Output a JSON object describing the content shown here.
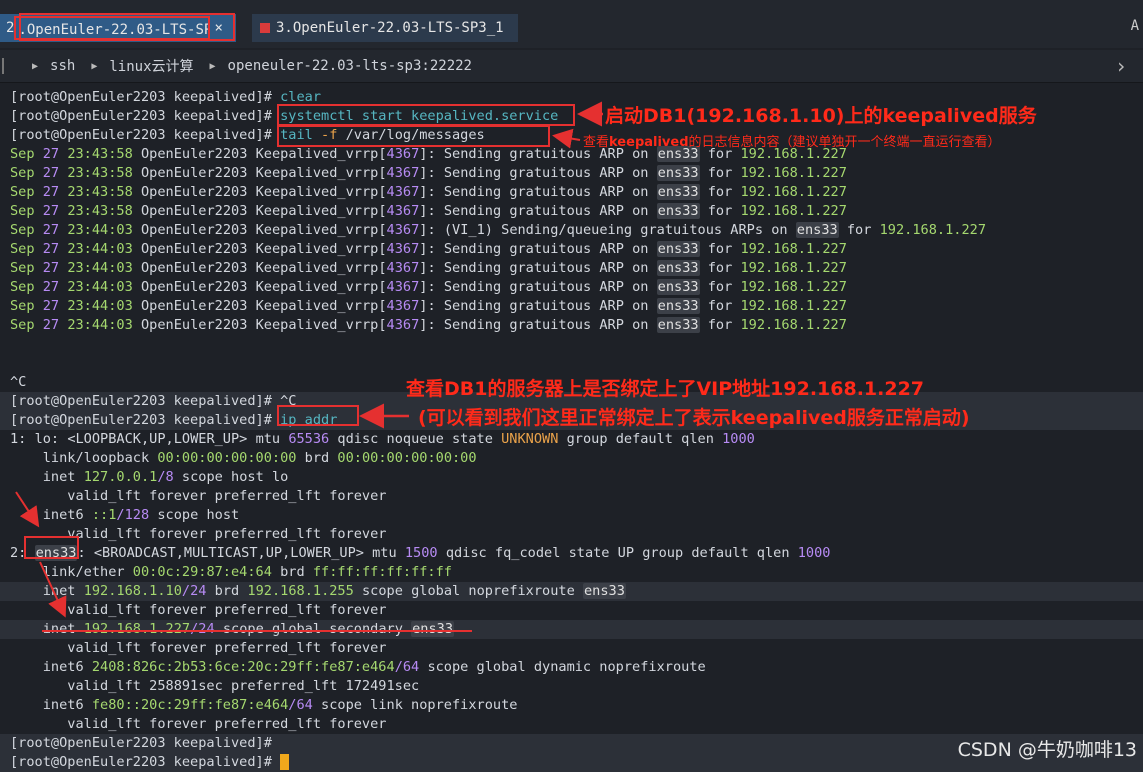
{
  "tabs": [
    {
      "num": "2",
      "title": ".OpenEuler-22.03-LTS-SP",
      "close": "×"
    },
    {
      "title": "3.OpenEuler-22.03-LTS-SP3_1"
    }
  ],
  "tab_overflow": "A",
  "breadcrumb": [
    "ssh",
    "linux云计算",
    "openeuler-22.03-lts-sp3:22222"
  ],
  "prompt": "[root@OpenEuler2203 keepalived]#",
  "commands": {
    "clear": "clear",
    "start": "systemctl start keepalived.service",
    "tail_a": "tail",
    "tail_f": "-f",
    "tail_b": "/var/log/messages",
    "ctrlc": "^C",
    "ipaddr": "ip addr"
  },
  "log": {
    "host": "OpenEuler2203",
    "proc": "Keepalived_vrrp",
    "pid": "4367",
    "msg": "Sending gratuitous ARP on",
    "iface": "ens33",
    "for": "for",
    "vip": "192.168.1.227",
    "vi_msg": "(VI_1) Sending/queueing gratuitous ARPs on",
    "lines": [
      {
        "month": "Sep",
        "day": "27",
        "time": "23:43:58",
        "vi": false
      },
      {
        "month": "Sep",
        "day": "27",
        "time": "23:43:58",
        "vi": false
      },
      {
        "month": "Sep",
        "day": "27",
        "time": "23:43:58",
        "vi": false
      },
      {
        "month": "Sep",
        "day": "27",
        "time": "23:43:58",
        "vi": false
      },
      {
        "month": "Sep",
        "day": "27",
        "time": "23:44:03",
        "vi": true
      },
      {
        "month": "Sep",
        "day": "27",
        "time": "23:44:03",
        "vi": false
      },
      {
        "month": "Sep",
        "day": "27",
        "time": "23:44:03",
        "vi": false
      },
      {
        "month": "Sep",
        "day": "27",
        "time": "23:44:03",
        "vi": false
      },
      {
        "month": "Sep",
        "day": "27",
        "time": "23:44:03",
        "vi": false
      },
      {
        "month": "Sep",
        "day": "27",
        "time": "23:44:03",
        "vi": false
      }
    ]
  },
  "ctrl_c_echo": "^C",
  "ipaddr": {
    "lo": {
      "idx": "1:",
      "name": "lo:",
      "flags": "<LOOPBACK,UP,LOWER_UP>",
      "rest1": "mtu",
      "mtu": "65536",
      "rest2": "qdisc noqueue state",
      "state": "UNKNOWN",
      "rest3": "group default qlen",
      "qlen": "1000",
      "link_a": "link/loopback",
      "link_mac": "00:00:00:00:00:00",
      "link_b": "brd",
      "link_brd": "00:00:00:00:00:00",
      "inet_a": "inet",
      "inet_ip": "127.0.0.1",
      "inet_pfx": "/8",
      "inet_b": "scope host lo",
      "valid1": "valid_lft forever preferred_lft forever",
      "inet6_a": "inet6",
      "inet6_ip": "::1",
      "inet6_pfx": "/128",
      "inet6_b": "scope host",
      "valid2": "valid_lft forever preferred_lft forever"
    },
    "ens": {
      "idx": "2:",
      "name": "ens33",
      "colon": ":",
      "flags": "<BROADCAST,MULTICAST,UP,LOWER_UP>",
      "rest1": "mtu",
      "mtu": "1500",
      "rest2": "qdisc fq_codel state UP group default qlen",
      "qlen": "1000",
      "link_a": "link/ether",
      "link_mac": "00:0c:29:87:e4:64",
      "link_b": "brd",
      "link_brd": "ff:ff:ff:ff:ff:ff",
      "inet1_a": "inet",
      "inet1_ip": "192.168.1.10",
      "inet1_pfx": "/24",
      "inet1_b": "brd",
      "inet1_brd": "192.168.1.255",
      "inet1_c": "scope global noprefixroute",
      "valid1": "valid_lft forever preferred_lft forever",
      "inet2_a": "inet",
      "inet2_ip": "192.168.1.227",
      "inet2_pfx": "/24",
      "inet2_b": "scope global secondary",
      "valid2": "valid_lft forever preferred_lft forever",
      "inet6a_a": "inet6",
      "inet6a_ip": "2408:826c:2b53:6ce:20c:29ff:fe87:e464",
      "inet6a_pfx": "/64",
      "inet6a_b": "scope global dynamic noprefixroute",
      "valid3": "valid_lft 258891sec preferred_lft 172491sec",
      "inet6b_a": "inet6",
      "inet6b_ip": "fe80::20c:29ff:fe87:e464",
      "inet6b_pfx": "/64",
      "inet6b_b": "scope link noprefixroute",
      "valid4": "valid_lft forever preferred_lft forever"
    }
  },
  "annotations": {
    "start": "启动DB1(192.168.1.10)上的keepalived服务",
    "tail_pre": "查看",
    "tail_bold": "keepalived",
    "tail_post": "的日志信息内容（建议单独开一个终端一直运行查看）",
    "vip_line1": "查看DB1的服务器上是否绑定上了VIP地址192.168.1.227",
    "vip_line2": "(可以看到我们这里正常绑定上了表示keepalived服务正常启动)"
  },
  "watermark": "CSDN @牛奶咖啡13",
  "colors": {
    "accent_red": "#e53030",
    "green": "#a5d86f",
    "purple": "#b78bf4",
    "orange": "#e9a24a",
    "cyan": "#56b6c2",
    "cursor": "#f0a81c"
  }
}
